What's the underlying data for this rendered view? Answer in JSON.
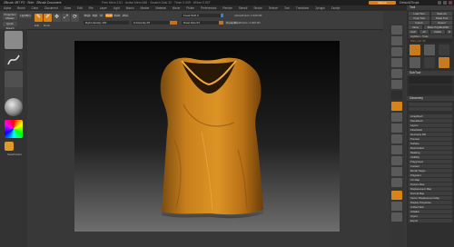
{
  "titlebar": {
    "title": "ZBrush 4R7 P3 · Shirt · ZBrush Document",
    "menu_text": "· Free Mem 2.51 · Active Mem 548 · Scratch Disk 32 · Timer 0.009 · ATime 0.007",
    "menus_label": "Menus",
    "script_label": "DefaultZScript"
  },
  "menubar": [
    "Alpha",
    "Brush",
    "Color",
    "Document",
    "Draw",
    "Edit",
    "File",
    "Layer",
    "Light",
    "Macro",
    "Marker",
    "Material",
    "Movie",
    "Picker",
    "Preferences",
    "Render",
    "Stencil",
    "Stroke",
    "Texture",
    "Tool",
    "Transform",
    "Zplugin",
    "Zscript"
  ],
  "toolbar": {
    "projection_master": "Projection Master",
    "lightbox": "LightBox",
    "quick_sketch": "Quick Sketch",
    "edit": "Edit",
    "draw": "Draw",
    "move": "Move",
    "scale": "Scale",
    "rotate": "Rotate",
    "mrgb": "Mrgb",
    "rgb": "Rgb",
    "m": "M",
    "zadd": "Zadd",
    "zsub": "Zsub",
    "zcut": "Zcut",
    "rgb_intensity": "Rgb Intensity 100",
    "z_intensity": "Z Intensity 25",
    "focal_shift": "Focal Shift 0",
    "draw_size": "Draw Size 64",
    "dynamic": "Dynamic",
    "active_points": "ActivePoints: 2.326 Mil",
    "total_points": "TotalPoints: 2.326 Mil"
  },
  "leftshelf": {
    "stroke_label": "DragRect",
    "texture_label": "Texture Off",
    "material_label": "MatCap",
    "color_label": "Gradient",
    "switch_label": "SwitchColor",
    "alternate_label": "Alternate"
  },
  "palette": {
    "tool_title": "Tool",
    "load_tool": "Load Tool",
    "save_as": "Save As",
    "copy_tool": "Copy Tool",
    "paste_tool": "Paste Tool",
    "import": "Import",
    "export": "Export",
    "clone": "Clone",
    "make_polymesh": "Make PolyMesh3D",
    "goz": "GoZ",
    "all": "All",
    "visible": "Visible",
    "r": "R",
    "lightbox_tools": "Lightbox › Tools",
    "current_tool": "Shirt_sub. 50",
    "subtool": "SubTool",
    "geometry": "Geometry",
    "arraymesh": "ArrayMesh",
    "nanomesh": "NanoMesh",
    "layers": "Layers",
    "fibermesh": "FiberMesh",
    "geometry_hd": "Geometry HD",
    "preview": "Preview",
    "surface": "Surface",
    "deformation": "Deformation",
    "masking": "Masking",
    "visibility": "Visibility",
    "polygroups": "Polygroups",
    "contact": "Contact",
    "morph_target": "Morph Target",
    "polypaint": "Polypaint",
    "uv_map": "UV Map",
    "texture_map": "Texture Map",
    "displacement": "Displacement Map",
    "normal_map": "Normal Map",
    "vector_displacement": "Vector Displacement Map",
    "display_properties": "Display Properties",
    "unified_skin": "Unified Skin",
    "initialize": "Initialize",
    "import2": "Import",
    "export2": "Export"
  },
  "colors": {
    "accent": "#d8821a",
    "shirt": "#c8801c"
  },
  "icons": {
    "stroke": "brush-stroke-icon",
    "material": "matcap-sphere-icon"
  }
}
